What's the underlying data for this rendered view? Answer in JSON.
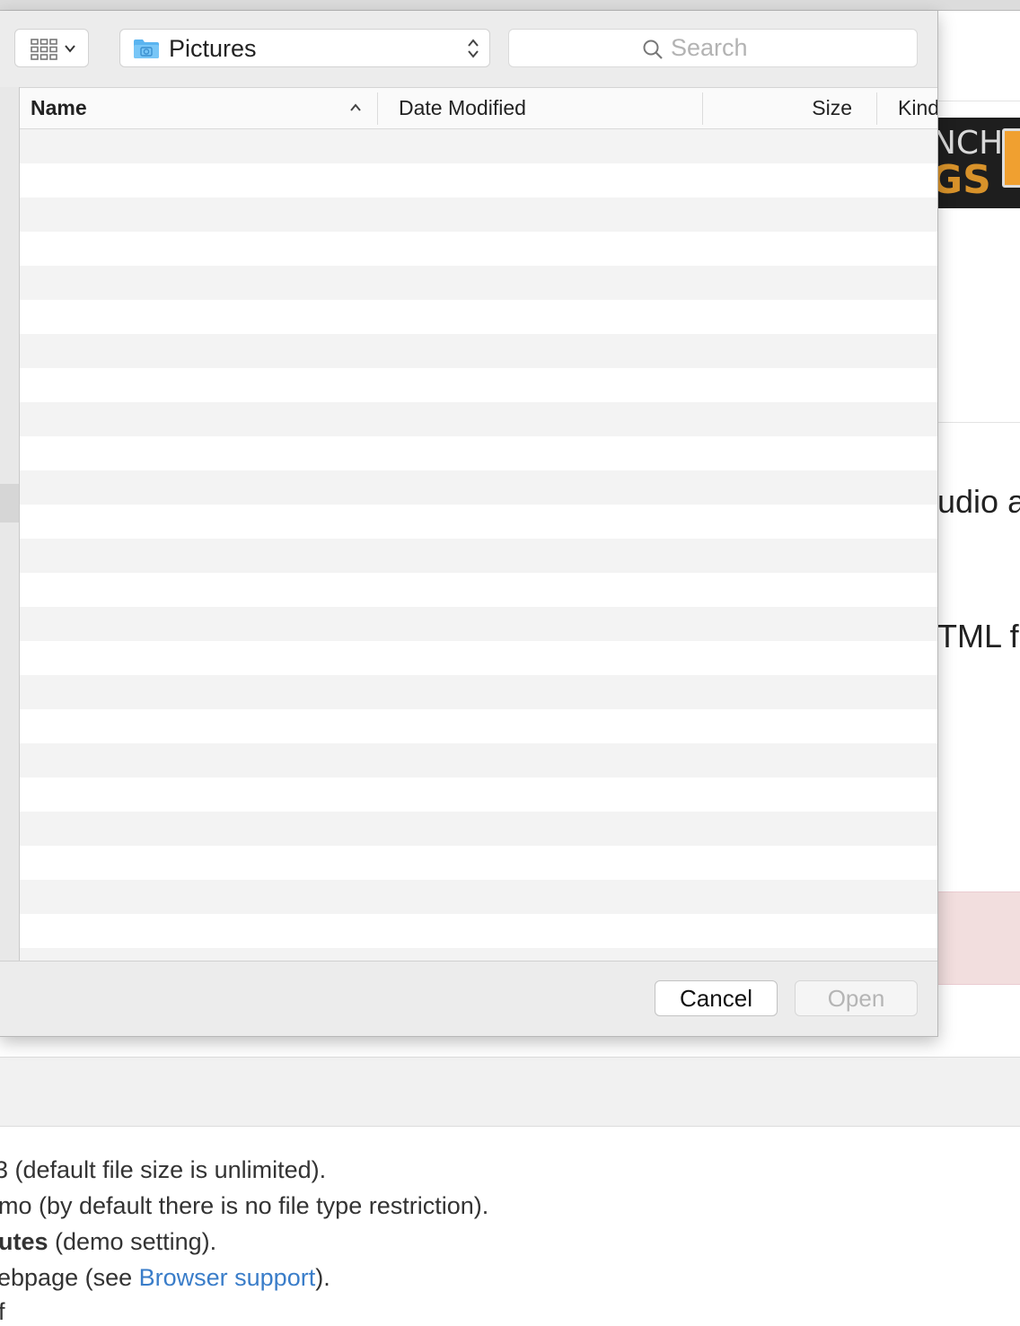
{
  "dialog": {
    "location": "Pictures",
    "search": {
      "placeholder": "Search",
      "value": ""
    },
    "columns": {
      "name": "Name",
      "date_modified": "Date Modified",
      "size": "Size",
      "kind": "Kind"
    },
    "sort": {
      "column": "Name",
      "direction": "ascending"
    },
    "cancel_label": "Cancel",
    "open_label": "Open",
    "open_enabled": false
  },
  "background_page": {
    "banner_text_top": "NCH",
    "banner_text_bottom": "GS",
    "heading_fragment_1": "udio a",
    "heading_fragment_2": "TML f",
    "lines": [
      {
        "parts": [
          {
            "text": "3 (default file size is unlimited)."
          }
        ]
      },
      {
        "parts": [
          {
            "text": "mo (by default there is no file type restriction)."
          }
        ]
      },
      {
        "parts": [
          {
            "text": "utes",
            "style": "bold"
          },
          {
            "text": " (demo setting)."
          }
        ]
      },
      {
        "parts": [
          {
            "text": "ebpage (see "
          },
          {
            "text": "Browser support",
            "style": "link"
          },
          {
            "text": ")."
          }
        ]
      },
      {
        "parts": [
          {
            "text": "f"
          }
        ]
      }
    ]
  },
  "colors": {
    "link": "#3a7dc9",
    "folder_icon": "#5ab4f0",
    "alert_background": "#f2dede"
  }
}
